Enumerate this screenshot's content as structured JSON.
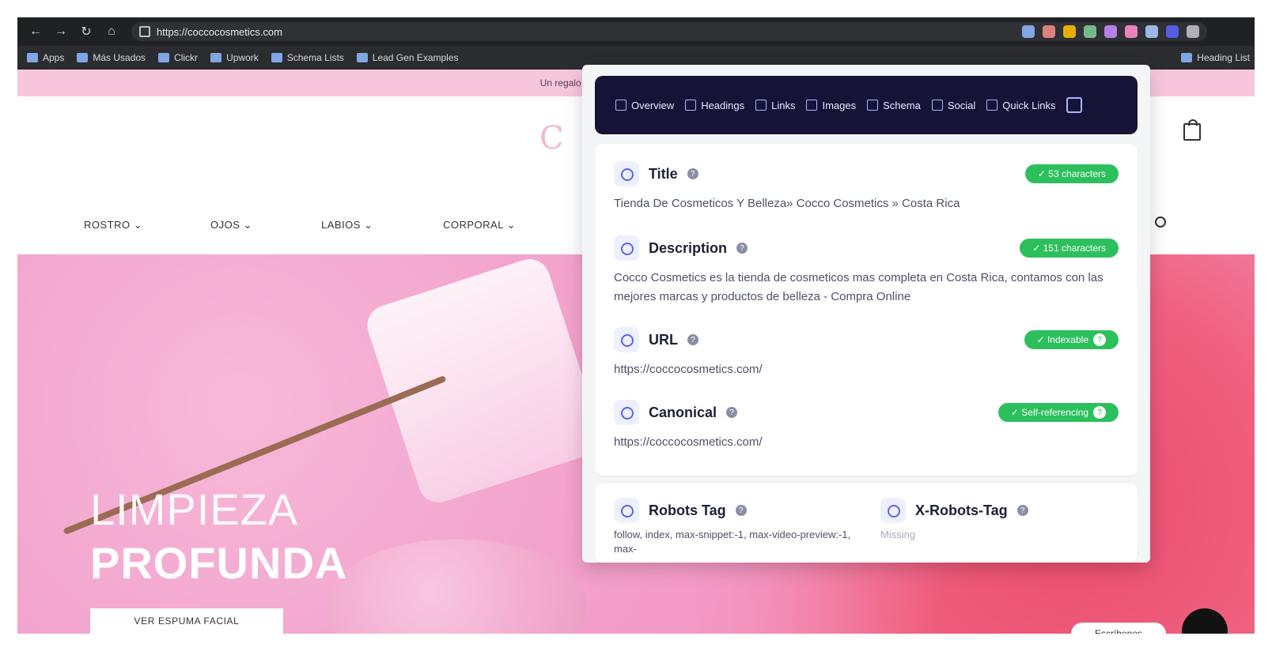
{
  "browser": {
    "url": "https://coccocosmetics.com",
    "bookmarks": [
      "Apps",
      "Más Usados",
      "Clickr",
      "Upwork",
      "Schema Lists",
      "Lead Gen Examples",
      "Heading List"
    ]
  },
  "site": {
    "announcement": "Un regalo para las mujeres en su mes. APRO",
    "logo_letter": "C",
    "menu": [
      "ROSTRO ⌄",
      "OJOS ⌄",
      "LABIOS ⌄",
      "CORPORAL ⌄"
    ],
    "hero": {
      "line1": "LIMPIEZA",
      "line2": "PROFUNDA",
      "cta": "VER ESPUMA FACIAL"
    },
    "chat_label": "Escríbenos"
  },
  "extension": {
    "tabs": [
      "Overview",
      "Headings",
      "Links",
      "Images",
      "Schema",
      "Social",
      "Quick Links"
    ],
    "fields": {
      "title": {
        "label": "Title",
        "badge": "✓ 53 characters",
        "value": "Tienda De Cosmeticos Y Belleza» Cocco Cosmetics » Costa Rica"
      },
      "description": {
        "label": "Description",
        "badge": "✓ 151 characters",
        "value": "Cocco Cosmetics es la tienda de cosmeticos mas completa en Costa Rica, contamos con las mejores marcas y productos de belleza - Compra Online"
      },
      "url": {
        "label": "URL",
        "badge": "✓ Indexable",
        "value": "https://coccocosmetics.com/"
      },
      "canonical": {
        "label": "Canonical",
        "badge": "✓ Self-referencing",
        "value": "https://coccocosmetics.com/"
      },
      "robots": {
        "label": "Robots Tag",
        "value": "follow, index, max-snippet:-1, max-video-preview:-1, max-"
      },
      "xrobots": {
        "label": "X-Robots-Tag",
        "value": "Missing"
      }
    },
    "help_glyph": "?",
    "info_glyph": "?"
  },
  "colors": {
    "popup_nav_bg": "#151437",
    "success_badge": "#2cc05d",
    "announcement_bg": "#f7c6dd"
  }
}
